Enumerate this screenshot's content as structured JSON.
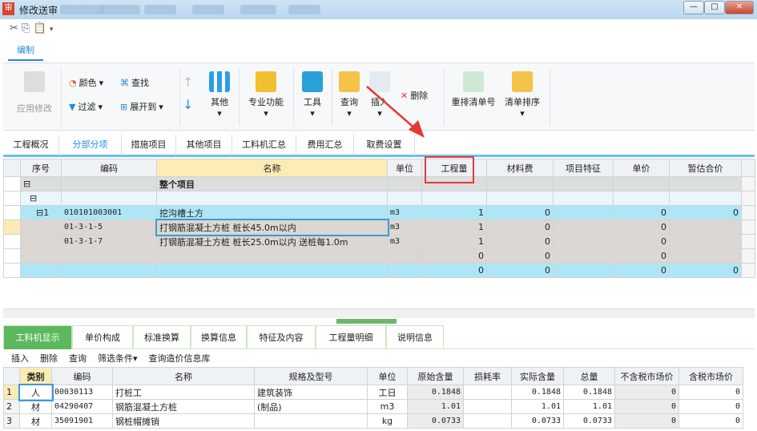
{
  "window": {
    "title": "修改送审",
    "icon": "审"
  },
  "ribbon": {
    "tab": "编制",
    "apply": "应用修改",
    "color": "颜色",
    "find": "查找",
    "filter": "过滤",
    "expand": "展开到",
    "other": "其他",
    "professional": "专业功能",
    "tools": "工具",
    "query": "查询",
    "insert": "插入",
    "delete": "删除",
    "renumber": "重排清单号",
    "sort": "清单排序"
  },
  "nav_tabs": [
    "工程概况",
    "分部分项",
    "措施项目",
    "其他项目",
    "工料机汇总",
    "费用汇总",
    "取费设置"
  ],
  "upper_grid": {
    "headers": [
      "序号",
      "编码",
      "名称",
      "单位",
      "工程量",
      "材料费",
      "项目特征",
      "单价",
      "暂估合价"
    ],
    "rows": [
      [
        "",
        "",
        "整个项目",
        "",
        "",
        "",
        "",
        "",
        ""
      ],
      [
        "",
        "",
        "",
        "",
        "",
        "",
        "",
        "",
        ""
      ],
      [
        "1",
        "010101003001",
        "挖沟槽土方",
        "m3",
        "1",
        "0",
        "",
        "0",
        "0"
      ],
      [
        "",
        "01-3-1-5",
        "打钢筋混凝土方桩 桩长45.0m以内",
        "m3",
        "1",
        "0",
        "",
        "0",
        ""
      ],
      [
        "",
        "01-3-1-7",
        "打钢筋混凝土方桩 桩长25.0m以内 送桩每1.0m",
        "m3",
        "1",
        "0",
        "",
        "0",
        ""
      ],
      [
        "",
        "",
        "",
        "",
        "0",
        "0",
        "",
        "0",
        ""
      ],
      [
        "",
        "",
        "",
        "",
        "0",
        "0",
        "",
        "0",
        "0"
      ]
    ]
  },
  "bottom_tabs": [
    "工料机显示",
    "单价构成",
    "标准换算",
    "换算信息",
    "特征及内容",
    "工程量明细",
    "说明信息"
  ],
  "bottom_toolbar": [
    "插入",
    "删除",
    "查询",
    "筛选条件▾",
    "查询造价信息库"
  ],
  "lower_grid": {
    "headers": [
      "",
      "类别",
      "编码",
      "名称",
      "规格及型号",
      "单位",
      "原始含量",
      "损耗率",
      "实际含量",
      "总量",
      "不含税市场价",
      "含税市场价"
    ],
    "rows": [
      [
        "1",
        "人",
        "00030113",
        "打桩工",
        "建筑装饰",
        "工日",
        "0.1848",
        "",
        "0.1848",
        "0.1848",
        "0",
        "0"
      ],
      [
        "2",
        "材",
        "04290407",
        "钢筋混凝土方桩",
        "(制品)",
        "m3",
        "1.01",
        "",
        "1.01",
        "1.01",
        "0",
        "0"
      ],
      [
        "3",
        "材",
        "35091901",
        "钢桩帽摊销",
        "",
        "kg",
        "0.0733",
        "",
        "0.0733",
        "0.0733",
        "0",
        "0"
      ]
    ]
  },
  "colors": {
    "accent": "#2a8bd8",
    "highlight_box": "#e53935",
    "bottom_tab_active": "#5cb85c",
    "row_blue": "#aee6f5",
    "row_gray": "#dcd7d2"
  }
}
